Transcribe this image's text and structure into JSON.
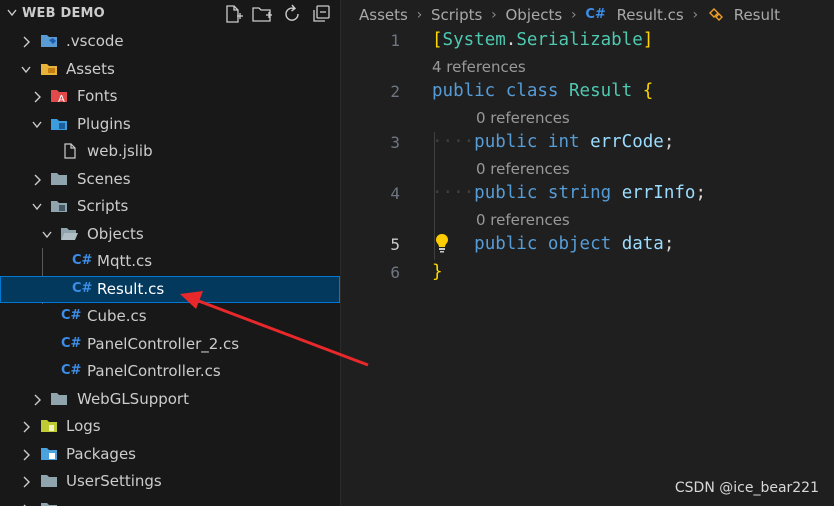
{
  "explorer": {
    "title": "WEB DEMO",
    "header_actions": [
      "new-file-icon",
      "new-folder-icon",
      "refresh-icon",
      "collapse-all-icon"
    ],
    "tree": [
      {
        "label": ".vscode",
        "type": "folder",
        "expanded": false,
        "icon": "vscode-folder-icon"
      },
      {
        "label": "Assets",
        "type": "folder",
        "expanded": true,
        "icon": "assets-folder-icon"
      },
      {
        "label": "Fonts",
        "type": "folder",
        "expanded": false,
        "icon": "fonts-folder-icon"
      },
      {
        "label": "Plugins",
        "type": "folder",
        "expanded": true,
        "icon": "plugins-folder-icon"
      },
      {
        "label": "web.jslib",
        "type": "file",
        "icon": "file-icon"
      },
      {
        "label": "Scenes",
        "type": "folder",
        "expanded": false,
        "icon": "folder-icon"
      },
      {
        "label": "Scripts",
        "type": "folder",
        "expanded": true,
        "icon": "scripts-folder-icon"
      },
      {
        "label": "Objects",
        "type": "folder",
        "expanded": true,
        "icon": "folder-open-icon"
      },
      {
        "label": "Mqtt.cs",
        "type": "file",
        "icon": "csharp-icon"
      },
      {
        "label": "Result.cs",
        "type": "file",
        "icon": "csharp-icon",
        "selected": true
      },
      {
        "label": "Cube.cs",
        "type": "file",
        "icon": "csharp-icon"
      },
      {
        "label": "PanelController_2.cs",
        "type": "file",
        "icon": "csharp-icon"
      },
      {
        "label": "PanelController.cs",
        "type": "file",
        "icon": "csharp-icon"
      },
      {
        "label": "WebGLSupport",
        "type": "folder",
        "expanded": false,
        "icon": "folder-icon"
      },
      {
        "label": "Logs",
        "type": "folder",
        "expanded": false,
        "icon": "logs-folder-icon"
      },
      {
        "label": "Packages",
        "type": "folder",
        "expanded": false,
        "icon": "packages-folder-icon"
      },
      {
        "label": "UserSettings",
        "type": "folder",
        "expanded": false,
        "icon": "folder-icon"
      }
    ],
    "csharp_glyph": "C#"
  },
  "editor": {
    "breadcrumb": [
      "Assets",
      "Scripts",
      "Objects",
      "Result.cs",
      "Result"
    ],
    "breadcrumb_cs_glyph": "C#",
    "lines": [
      {
        "number": "1",
        "text": "[System.Serializable]"
      },
      {
        "codelens": "4 references"
      },
      {
        "number": "2",
        "text": "public class Result {"
      },
      {
        "codelens": "0 references"
      },
      {
        "number": "3",
        "text": "public int errCode;"
      },
      {
        "codelens": "0 references"
      },
      {
        "number": "4",
        "text": "public string errInfo;"
      },
      {
        "codelens": "0 references"
      },
      {
        "number": "5",
        "text": "public object data;"
      },
      {
        "number": "6",
        "text": "}"
      }
    ],
    "active_line": "5",
    "tokens": {
      "l1_open": "[",
      "l1_sys": "System",
      "l1_dot": ".",
      "l1_ser": "Serializable",
      "l1_close": "]",
      "l2_public": "public",
      "l2_class": "class",
      "l2_name": "Result",
      "l2_brace": "{",
      "l3_public": "public",
      "l3_type": "int",
      "l3_name": "errCode",
      "l3_semi": ";",
      "l4_public": "public",
      "l4_type": "string",
      "l4_name": "errInfo",
      "l4_semi": ";",
      "l5_public": "public",
      "l5_type": "object",
      "l5_name": "data",
      "l5_semi": ";",
      "l6_brace": "}",
      "indent_dots": "····"
    }
  },
  "watermark": "CSDN @ice_bear221",
  "colors": {
    "sidebar_bg": "#181818",
    "editor_bg": "#1f1f1f",
    "selection_bg": "#04395e",
    "selection_border": "#0078d4",
    "keyword": "#569cd6",
    "type_name": "#4ec9b0",
    "variable": "#9cdcfe",
    "bracket": "#ffd700",
    "annotation_arrow": "#e8282b"
  }
}
